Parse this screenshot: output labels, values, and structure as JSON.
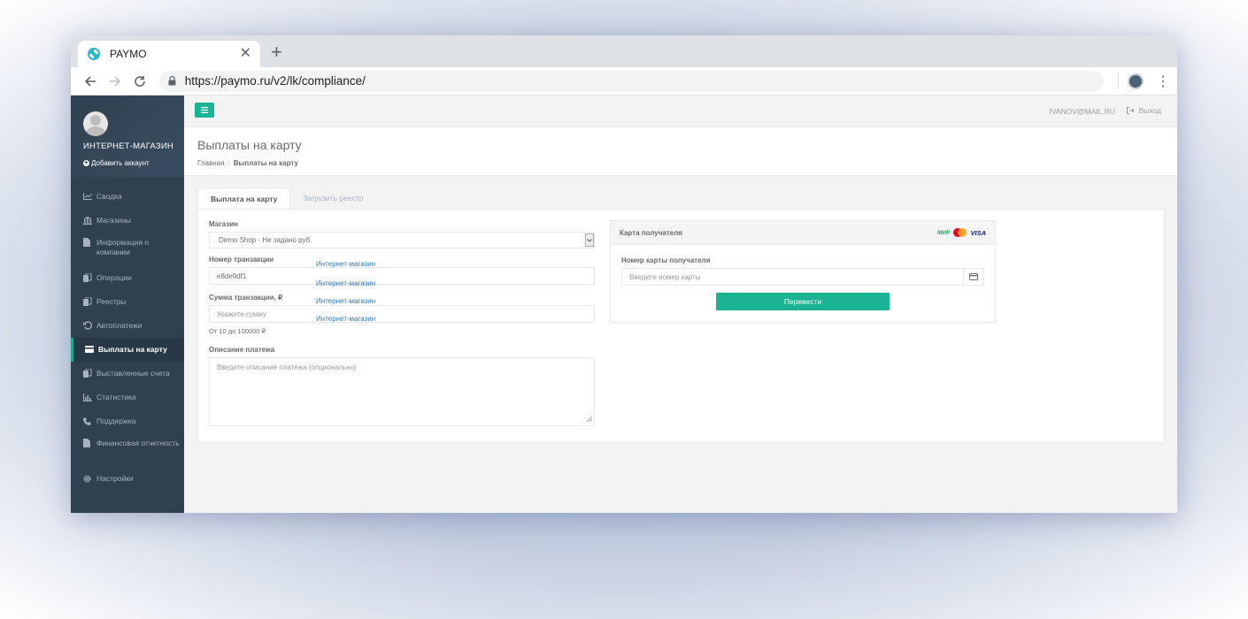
{
  "browser": {
    "tab_title": "PAYMO",
    "url": "https://paymo.ru/v2/lk/compliance/"
  },
  "sidebar": {
    "shop_name": "ИНТЕРНЕТ-МАГАЗИН",
    "add_account": "Добавить аккаунт",
    "items": [
      {
        "label": "Сводка",
        "icon": "chart-line-icon"
      },
      {
        "label": "Магазины",
        "icon": "bank-icon"
      },
      {
        "label": "Информация о компании",
        "icon": "file-icon"
      },
      {
        "label": "Операции",
        "icon": "files-icon"
      },
      {
        "label": "Реестры",
        "icon": "files-icon"
      },
      {
        "label": "Автоплатежи",
        "icon": "history-icon"
      },
      {
        "label": "Выплаты на карту",
        "icon": "credit-card-icon"
      },
      {
        "label": "Выставленные счета",
        "icon": "files-icon"
      },
      {
        "label": "Статистика",
        "icon": "bar-chart-icon"
      },
      {
        "label": "Поддержка",
        "icon": "phone-icon"
      },
      {
        "label": "Финансовая отчетность",
        "icon": "file-icon"
      },
      {
        "label": "Настройки",
        "icon": "gear-icon"
      }
    ],
    "active_index": 6
  },
  "topbar": {
    "user_email": "IVANOV@MAIL.RU",
    "logout": "Выход"
  },
  "heading": {
    "title": "Выплаты на карту",
    "breadcrumb_home": "Главная",
    "breadcrumb_current": "Выплаты на карту"
  },
  "tabs": [
    "Выплата на карту",
    "Загрузить реестр"
  ],
  "form": {
    "shop_label": "Магазин",
    "shop_value": "Demo Shop - Не задано руб.",
    "txn_label": "Номер транзакции",
    "txn_value": "e8de9df1",
    "amount_label": "Сумма транзакции, ₽",
    "amount_placeholder": "Укажите сумму",
    "amount_hint": "От 10 до 100000 ₽",
    "desc_label": "Описание платежа",
    "desc_placeholder": "Введите описание платежа (опционально)",
    "links": [
      "Интернет-магазин",
      "Интернет-магазин",
      "Интернет-магазин",
      "Интернет-магазин"
    ]
  },
  "card": {
    "title": "Карта получателя",
    "brand_mir": "МИР",
    "brand_visa": "VISA",
    "number_label": "Номер карты получателя",
    "number_placeholder": "Введите номер карты",
    "submit": "Перевести"
  },
  "colors": {
    "sidebar_bg": "#2f4050",
    "accent": "#1ab394",
    "link": "#337ab7"
  }
}
